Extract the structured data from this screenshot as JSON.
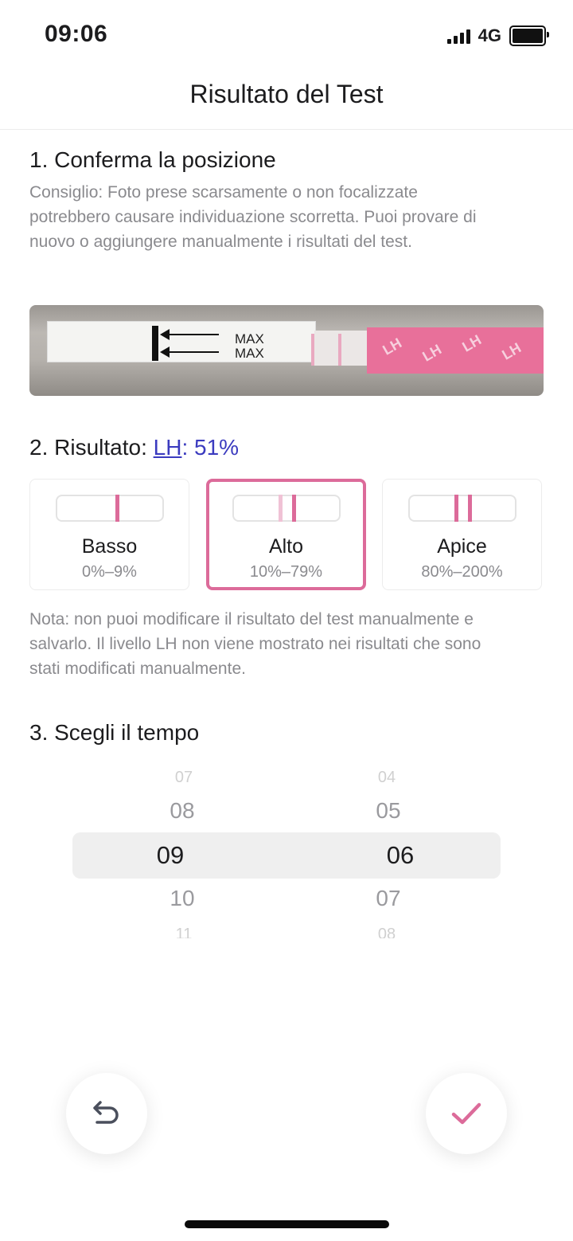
{
  "status_bar": {
    "time": "09:06",
    "network": "4G"
  },
  "nav": {
    "title": "Risultato del Test"
  },
  "section1": {
    "title": "1. Conferma la posizione",
    "tip_lines": [
      "Consiglio: Foto prese scarsamente o non focalizzate",
      "potrebbero causare individuazione scorretta. Puoi provare di",
      "nuovo o aggiungere manualmente i risultati del test."
    ],
    "strip_text": [
      "MAX",
      "MAX"
    ]
  },
  "section2": {
    "title_prefix": "2. Risultato:",
    "lh_label": "LH",
    "lh_value": ": 51%",
    "cards": [
      {
        "label": "Basso",
        "range": "0%–9%"
      },
      {
        "label": "Alto",
        "range": "10%–79%"
      },
      {
        "label": "Apice",
        "range": "80%–200%"
      }
    ],
    "note_lines": [
      "Nota: non puoi modificare il risultato del test manualmente e",
      "salvarlo. Il livello LH non viene mostrato nei risultati che sono",
      "stati modificati manualmente."
    ]
  },
  "section3": {
    "title": "3. Scegli il tempo",
    "hours": [
      "07",
      "08",
      "09",
      "10",
      "11"
    ],
    "minutes": [
      "04",
      "05",
      "06",
      "07",
      "08"
    ]
  },
  "colors": {
    "accent_pink": "#dc6b9a",
    "link_blue": "#3b3bbf"
  },
  "icons": {
    "back": "undo-arrow-icon",
    "confirm": "checkmark-icon"
  }
}
